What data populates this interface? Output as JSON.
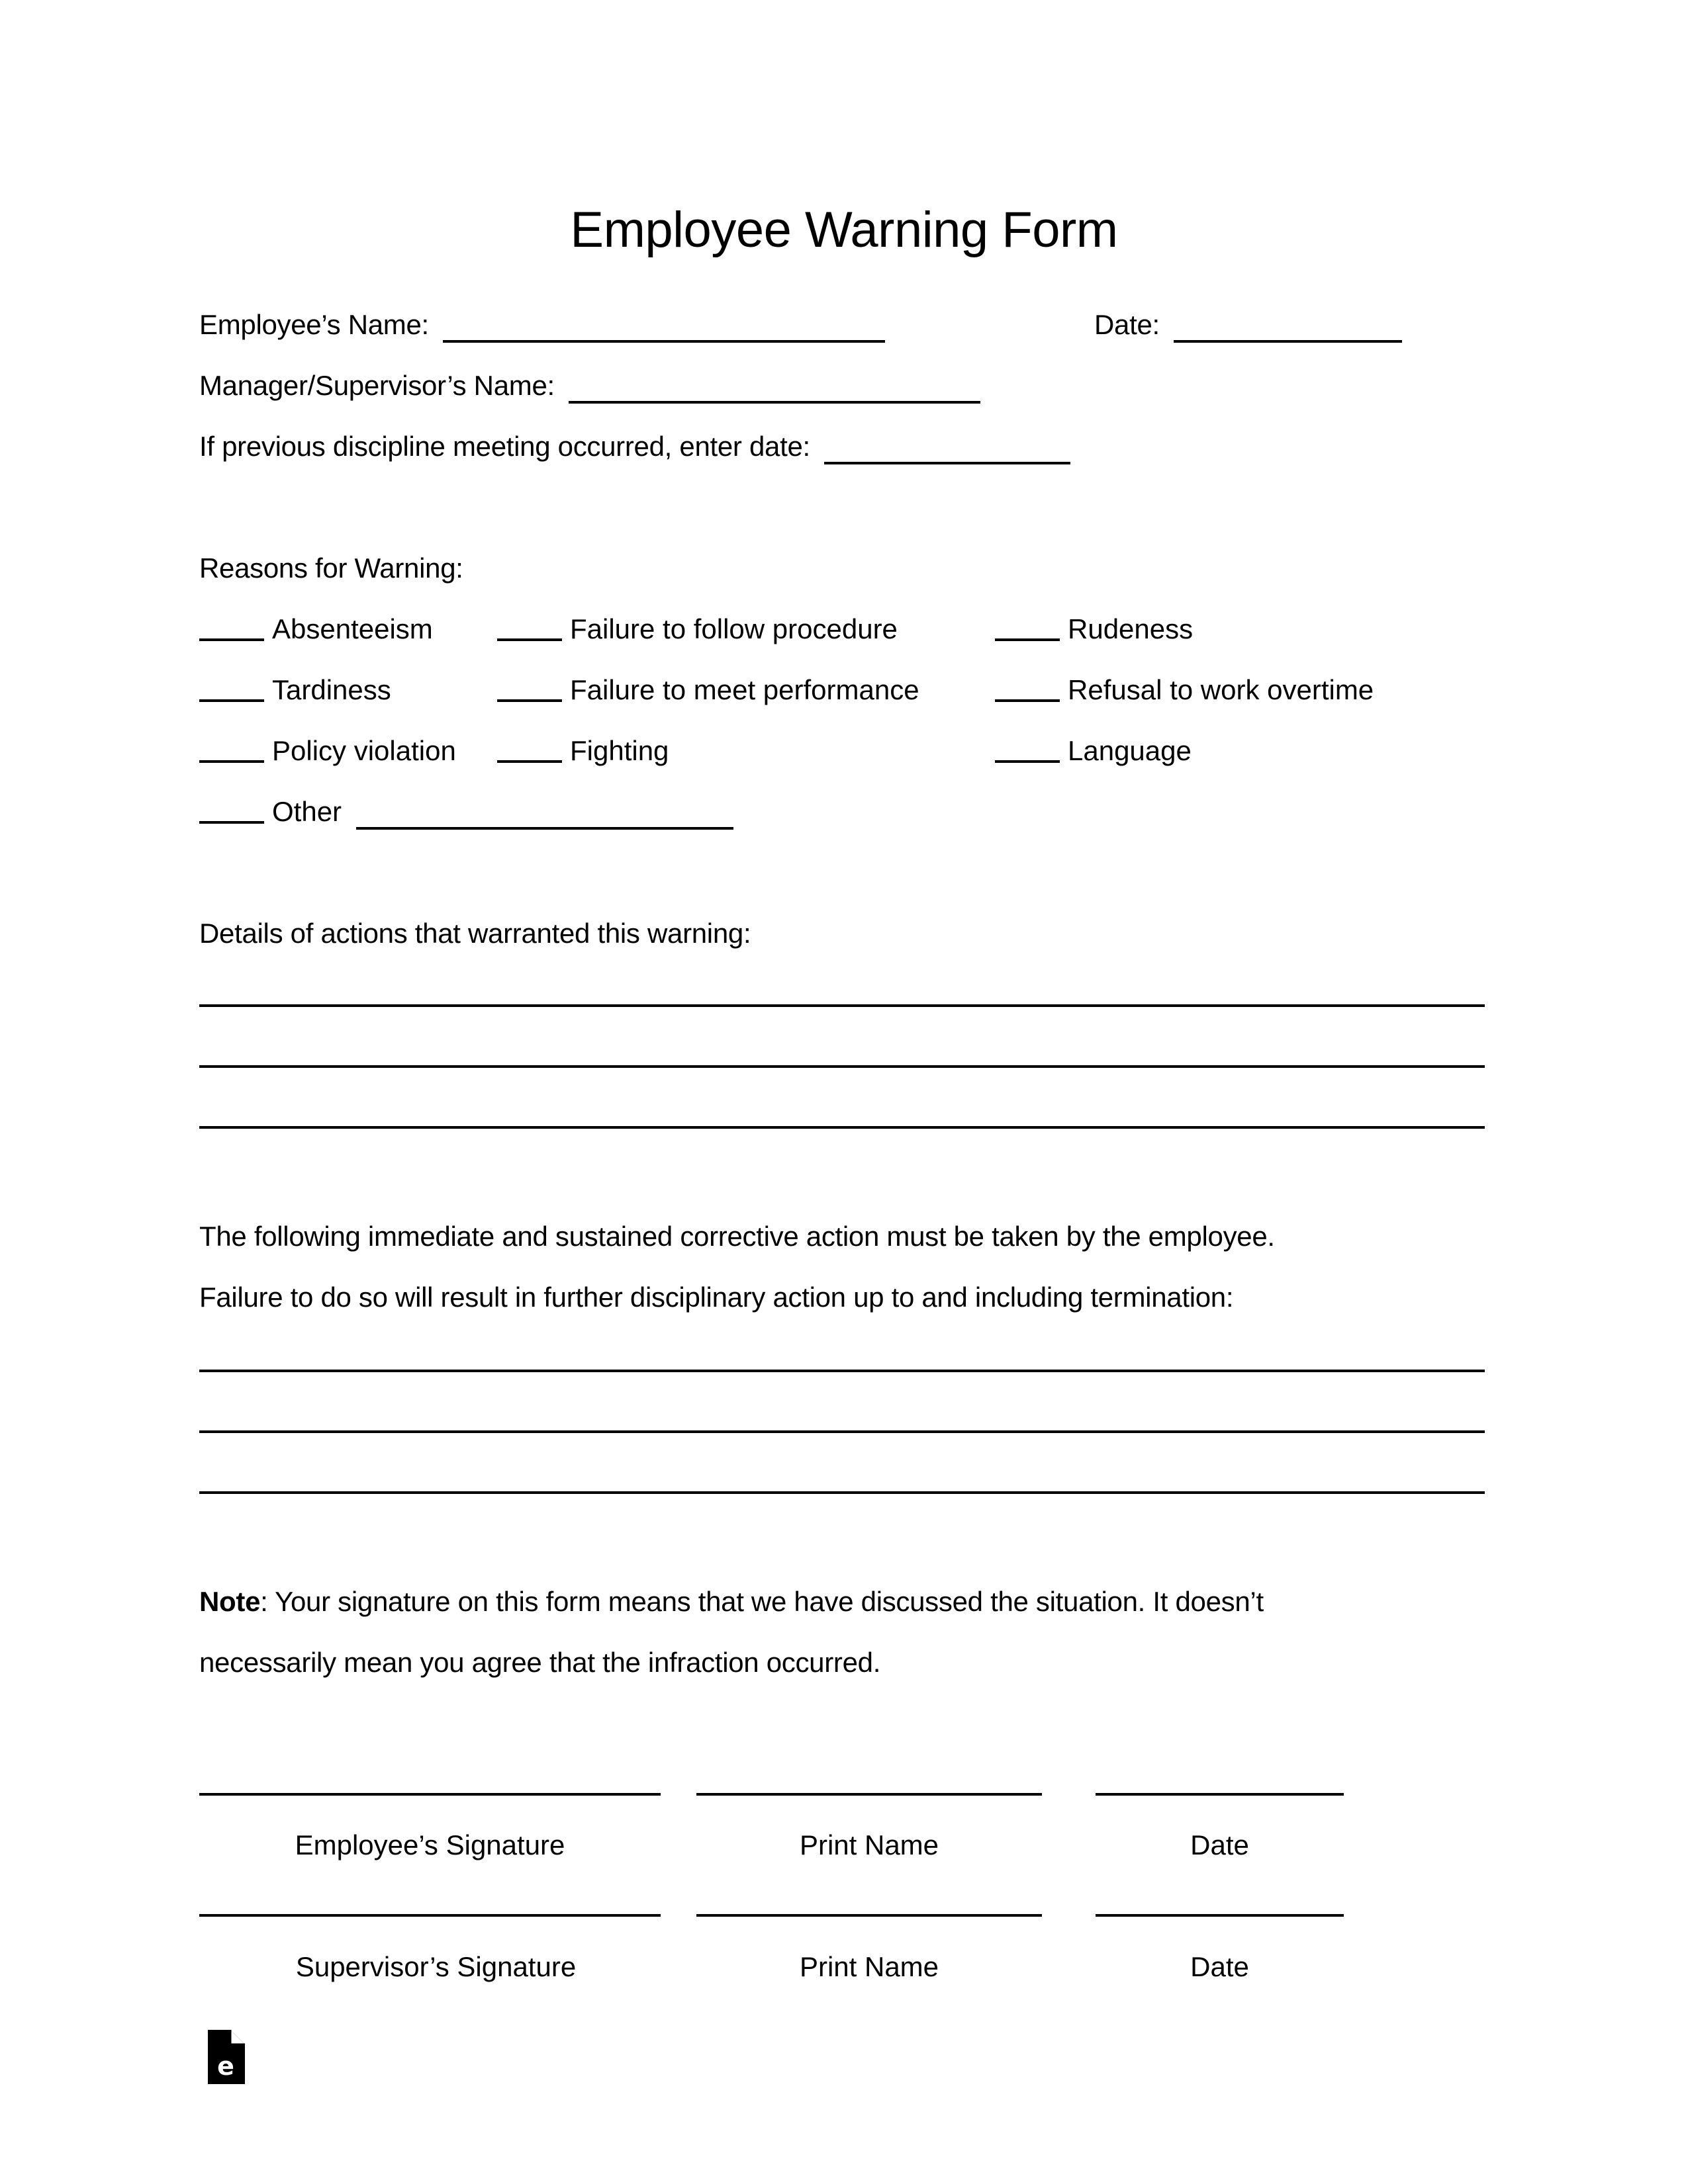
{
  "document": {
    "title": "Employee Warning Form"
  },
  "header_fields": {
    "employee_name_label": "Employee’s Name:",
    "employee_name_value": "",
    "date_label": "Date:",
    "date_value": "",
    "manager_name_label": "Manager/Supervisor’s Name:",
    "manager_name_value": "",
    "previous_meeting_label": "If previous discipline meeting occurred, enter date:",
    "previous_meeting_value": ""
  },
  "reasons": {
    "heading": "Reasons for Warning:",
    "items": [
      {
        "label": "Absenteeism",
        "checked": false
      },
      {
        "label": "Failure to follow procedure",
        "checked": false
      },
      {
        "label": "Rudeness",
        "checked": false
      },
      {
        "label": "Tardiness",
        "checked": false
      },
      {
        "label": "Failure to meet performance",
        "checked": false
      },
      {
        "label": "Refusal to work overtime",
        "checked": false
      },
      {
        "label": "Policy violation",
        "checked": false
      },
      {
        "label": "Fighting",
        "checked": false
      },
      {
        "label": "Language",
        "checked": false
      }
    ],
    "other_label": "Other",
    "other_value": ""
  },
  "details": {
    "heading": "Details of actions that warranted this warning:",
    "lines": [
      "",
      "",
      ""
    ]
  },
  "corrective_action": {
    "text_line_1": "The following immediate and sustained corrective action must be taken by the employee.",
    "text_line_2": "Failure to do so will result in further disciplinary action up to and including termination:",
    "lines": [
      "",
      "",
      ""
    ]
  },
  "note": {
    "bold_label": "Note",
    "text_line_1": ": Your signature on this form means that we have discussed the situation. It doesn’t",
    "text_line_2": "necessarily mean you agree that the infraction occurred."
  },
  "signatures": {
    "employee": {
      "signature_label": "Employee’s Signature",
      "print_name_label": "Print Name",
      "date_label": "Date"
    },
    "supervisor": {
      "signature_label": "Supervisor’s Signature",
      "print_name_label": "Print Name",
      "date_label": "Date"
    }
  },
  "footer": {
    "logo_icon": "document-e-logo-icon",
    "logo_letter": "e"
  }
}
